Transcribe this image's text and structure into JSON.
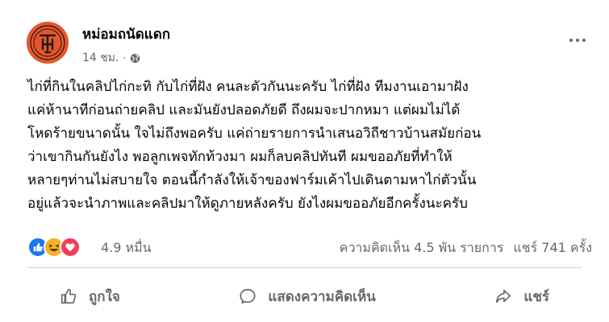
{
  "page": {
    "name": "หม่อมถนัดแดก",
    "time": "14 ชม.",
    "separator": "·",
    "audience_icon": "globe-icon"
  },
  "post": {
    "lines": [
      "ไก่ที่กินในคลิปไก่กะทิ กับไก่ที่ฝัง คนละตัวกันนะครับ ไก่ที่ฝัง ทีมงานเอามาฝัง",
      "แค่ห้านาทีก่อนถ่ายคลิป และมันยังปลอดภัยดี ถึงผมจะปากหมา แต่ผมไม่ได้",
      "โหดร้ายขนาดนั้น ใจไม่ถึงพอครับ แค่ถ่ายรายการนำเสนอวิถีชาวบ้านสมัยก่อน",
      "ว่าเขากินกันยังไง พอลูกเพจทักท้วงมา ผมก็ลบคลิปทันที ผมขออภัยที่ทำให้",
      "หลายๆท่านไม่สบายใจ ตอนนี้กำลังให้เจ้าของฟาร์มเค้าไปเดินตามหาไก่ตัวนั้น",
      "อยู่แล้วจะนำภาพและคลิปมาให้ดูภายหลังครับ ยังไงผมขออภัยอีกครั้งนะครับ"
    ]
  },
  "stats": {
    "reactions": [
      "like-icon",
      "haha-icon",
      "love-icon"
    ],
    "reaction_count": "4.9 หมื่น",
    "comments": "ความคิดเห็น 4.5 พัน รายการ",
    "shares": "แชร์ 741 ครั้ง"
  },
  "actions": {
    "like": "ถูกใจ",
    "comment": "แสดงความคิดเห็น",
    "share": "แชร์"
  },
  "colors": {
    "avatar_bg": "#e8552a",
    "text": "#050505",
    "secondary": "#65676b",
    "like_blue": "#1877f2",
    "love_red": "#f33e58",
    "haha_yellow": "#f7b125"
  }
}
